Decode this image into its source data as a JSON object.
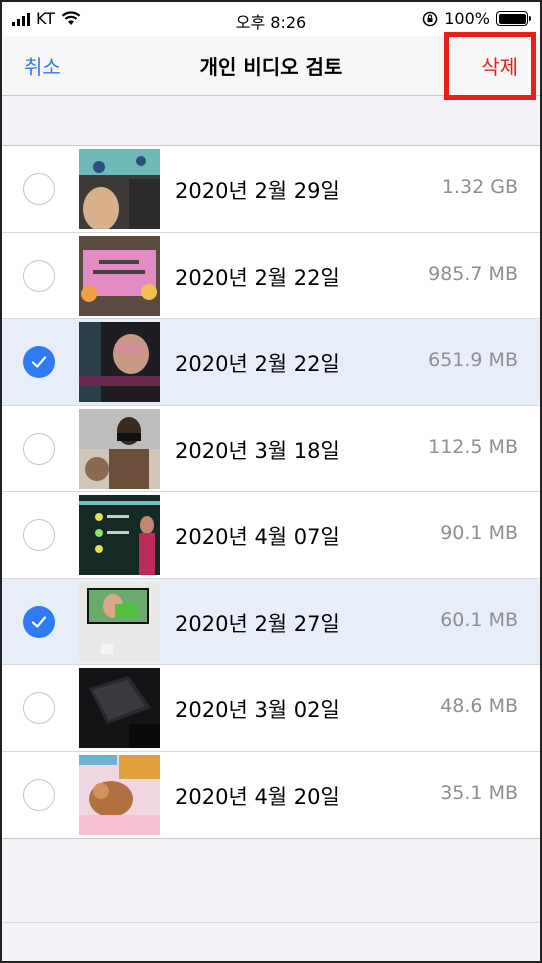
{
  "status_bar": {
    "carrier": "KT",
    "time": "오후 8:26",
    "battery": "100%",
    "battery_level": 1.0,
    "icons": [
      "signal-icon",
      "wifi-icon",
      "orientation-lock-icon",
      "battery-icon"
    ]
  },
  "nav": {
    "cancel_label": "취소",
    "title": "개인 비디오 검토",
    "delete_label": "삭제"
  },
  "colors": {
    "accent": "#3478f6",
    "destructive": "#e8201c",
    "selected_row": "#e8eef9",
    "secondary_text": "#8e8e93"
  },
  "videos": [
    {
      "date": "2020년 2월 29일",
      "size": "1.32 GB",
      "selected": false
    },
    {
      "date": "2020년 2월 22일",
      "size": "985.7 MB",
      "selected": false
    },
    {
      "date": "2020년 2월 22일",
      "size": "651.9 MB",
      "selected": true
    },
    {
      "date": "2020년 3월 18일",
      "size": "112.5 MB",
      "selected": false
    },
    {
      "date": "2020년 4월 07일",
      "size": "90.1 MB",
      "selected": false
    },
    {
      "date": "2020년 2월 27일",
      "size": "60.1 MB",
      "selected": true
    },
    {
      "date": "2020년 3월 02일",
      "size": "48.6 MB",
      "selected": false
    },
    {
      "date": "2020년 4월 20일",
      "size": "35.1 MB",
      "selected": false
    }
  ]
}
